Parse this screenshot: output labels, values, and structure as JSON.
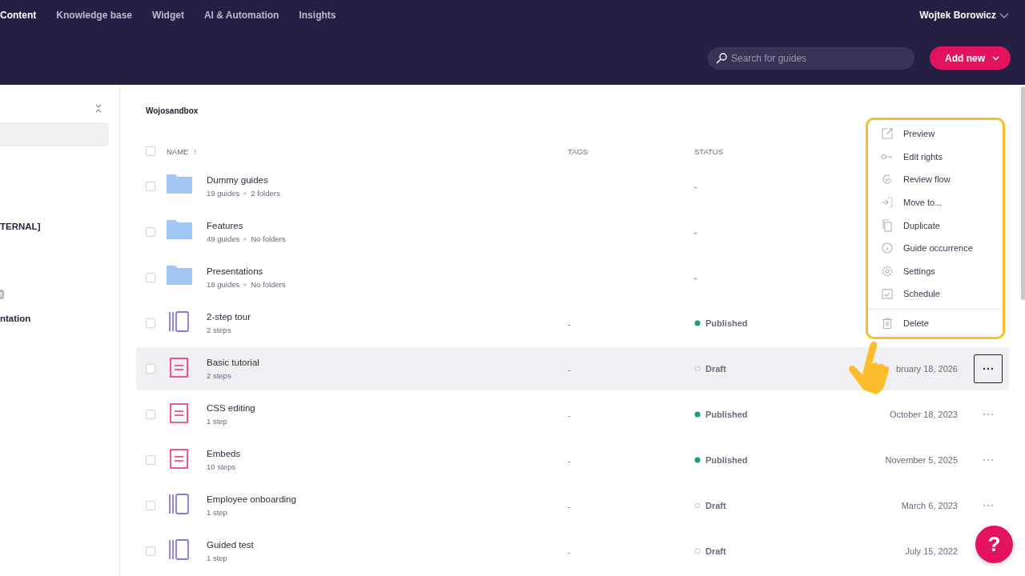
{
  "nav": {
    "tabs": [
      {
        "label": "Content",
        "selected": true
      },
      {
        "label": "Knowledge base",
        "selected": false
      },
      {
        "label": "Widget",
        "selected": false
      },
      {
        "label": "AI & Automation",
        "selected": false
      },
      {
        "label": "Insights",
        "selected": false
      }
    ],
    "user": "Wojtek Borowicz"
  },
  "toolbar": {
    "search": {
      "placeholder": "Search for guides"
    },
    "add_button": "Add new"
  },
  "sidebar": {
    "items": [
      {
        "selected": true
      },
      {
        "label": "TERNAL]",
        "selected": false
      },
      {
        "label": "ntation",
        "selected": false,
        "badge": "t"
      }
    ]
  },
  "breadcrumb": "Wojosandbox",
  "table": {
    "columns": [
      "NAME",
      "TAGS",
      "STATUS"
    ],
    "sort_mark": "↑",
    "select_all": {
      "checked": false
    },
    "rows": [
      {
        "kind": "folder",
        "name": "Dummy guides",
        "meta": [
          "19 guides",
          "2 folders"
        ],
        "status": "-",
        "active": false
      },
      {
        "kind": "folder",
        "name": "Features",
        "meta": [
          "49 guides",
          "No folders"
        ],
        "status": "-",
        "active": false
      },
      {
        "kind": "folder",
        "name": "Presentations",
        "meta": [
          "18 guides",
          "No folders"
        ],
        "status": "-",
        "active": false
      },
      {
        "kind": "tour",
        "name": "2-step tour",
        "meta": [
          "2 steps"
        ],
        "tags": "-",
        "status": "Published",
        "published": true,
        "active": false
      },
      {
        "kind": "tutorial",
        "name": "Basic tutorial",
        "meta": [
          "2 steps"
        ],
        "tags": "-",
        "status": "Draft",
        "published": false,
        "date": "bruary 18, 2026",
        "active": true
      },
      {
        "kind": "tutorial",
        "name": "CSS editing",
        "meta": [
          "1 step"
        ],
        "tags": "-",
        "status": "Published",
        "published": true,
        "date": "October 18, 2023",
        "active": false
      },
      {
        "kind": "tutorial",
        "name": "Embeds",
        "meta": [
          "10 steps"
        ],
        "tags": "-",
        "status": "Published",
        "published": true,
        "date": "November 5, 2025",
        "active": false
      },
      {
        "kind": "tour",
        "name": "Employee onboarding",
        "meta": [
          "1 step"
        ],
        "tags": "-",
        "status": "Draft",
        "published": false,
        "date": "March 6, 2023",
        "active": false
      },
      {
        "kind": "tour",
        "name": "Guided test",
        "meta": [
          "1 step"
        ],
        "tags": "-",
        "status": "Draft",
        "published": false,
        "date": "July 15, 2022",
        "active": false
      }
    ]
  },
  "context_menu": {
    "groups": [
      [
        "Preview",
        "Edit rights",
        "Review flow",
        "Move to...",
        "Duplicate",
        "Guide occurrence",
        "Settings",
        "Schedule"
      ],
      [
        "Delete"
      ]
    ]
  },
  "help_button": "?"
}
